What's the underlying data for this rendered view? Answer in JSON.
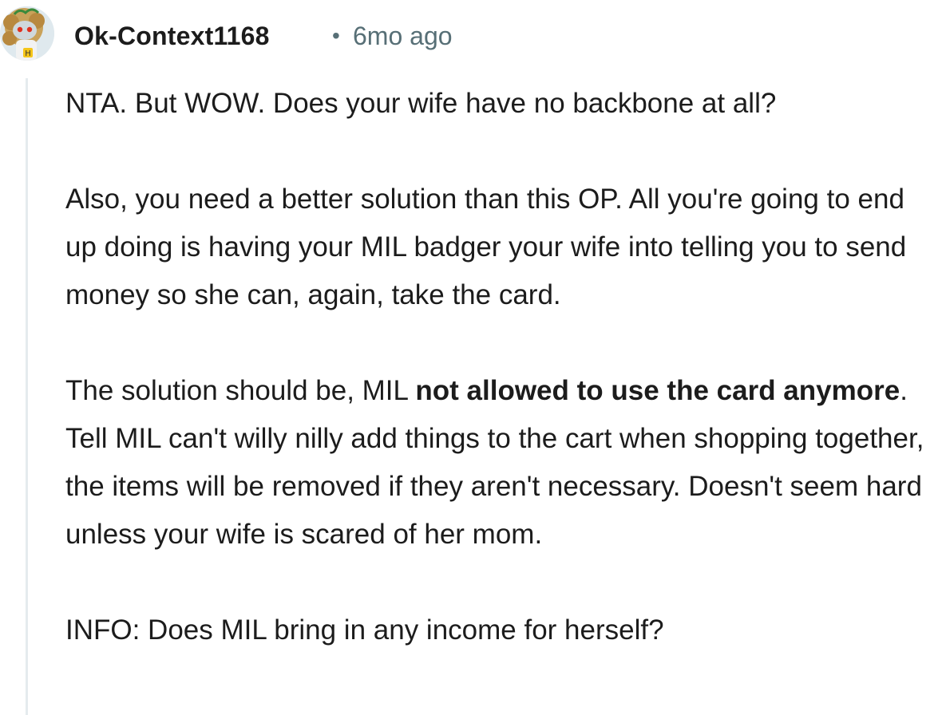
{
  "comment": {
    "username": "Ok-Context1168",
    "separator": "•",
    "timestamp": "6mo ago",
    "avatar_icon": "snoo-avatar-icon",
    "paragraphs": {
      "p1": "NTA. But WOW. Does your wife have no backbone at all?",
      "p2": "Also, you need a better solution than this OP. All you're going to end up doing is having your MIL badger your wife into telling you to send money so she can, again, take the card.",
      "p3_before": "The solution should be, MIL ",
      "p3_bold": "not allowed to use the card anymore",
      "p3_after": ". Tell MIL can't willy nilly add things to the cart when shopping together, the items will be removed if they aren't necessary. Doesn't seem hard unless your wife is scared of her mom.",
      "p4": "INFO: Does MIL bring in any income for herself?"
    }
  },
  "colors": {
    "text": "#1c1c1c",
    "meta": "#576f76",
    "thread_line": "#e5ebee"
  }
}
